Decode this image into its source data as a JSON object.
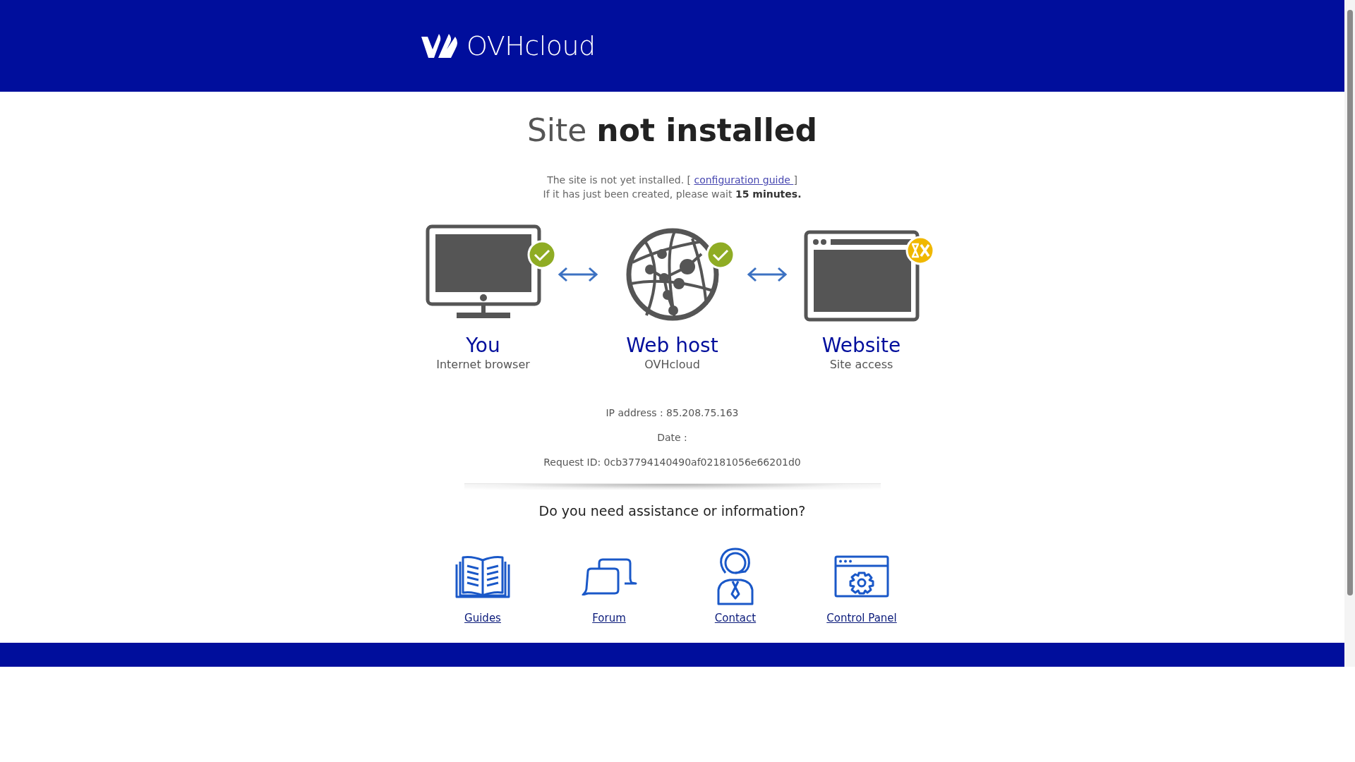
{
  "header": {
    "logo_text": "OVHcloud"
  },
  "title": "Site **not installed**",
  "message": {
    "text_before": "The site is not yet installed. [",
    "link": "configuration guide",
    "text_after": "]",
    "line_2": "If it has just been created, please wait **15 minutes.**"
  },
  "steps": [
    {
      "kind": "computer",
      "title": "You",
      "subtitle": "Internet browser",
      "ready": true
    },
    {
      "kind": "globe",
      "title": "Web host",
      "subtitle": "OVHcloud",
      "ready": true
    },
    {
      "kind": "website",
      "title": "Website",
      "subtitle": "Site access",
      "ready": false
    }
  ],
  "info": [
    "IP address : 85.208.75.163",
    "Date :",
    "Request ID: 0cb37794140490af02181056e66201d0"
  ],
  "help": {
    "heading": "Do you need assistance or information?",
    "links": [
      {
        "kind": "guides",
        "label": "Guides"
      },
      {
        "kind": "forum",
        "label": "Forum"
      },
      {
        "kind": "contact",
        "label": "Contact"
      },
      {
        "kind": "panel",
        "label": "Control Panel"
      }
    ]
  }
}
